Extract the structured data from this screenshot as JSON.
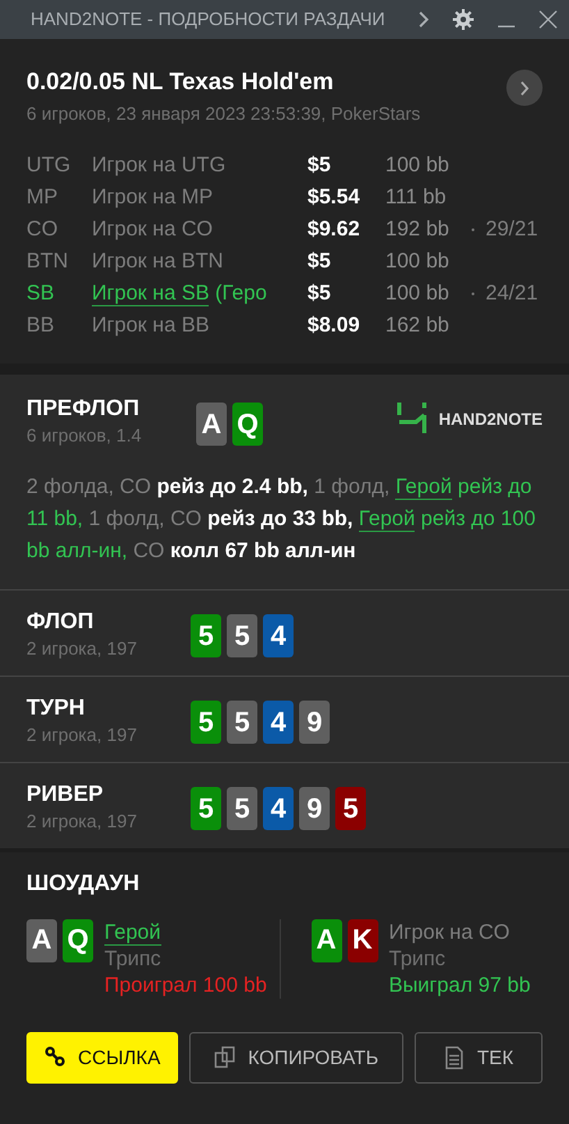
{
  "window": {
    "title": "HAND2NOTE - ПОДРОБНОСТИ РАЗДАЧИ"
  },
  "hand": {
    "title": "0.02/0.05 NL Texas Hold'em",
    "subtitle": "6 игроков, 23 января 2023 23:53:39, PokerStars"
  },
  "players": [
    {
      "position": "UTG",
      "name": "Игрок на UTG",
      "stack": "$5",
      "bb": "100 bb",
      "hero": false
    },
    {
      "position": "MP",
      "name": "Игрок на MP",
      "stack": "$5.54",
      "bb": "111 bb",
      "hero": false
    },
    {
      "position": "CO",
      "name": "Игрок на CO",
      "stack": "$9.62",
      "bb": "192 bb",
      "stat": "29/21",
      "hero": false
    },
    {
      "position": "BTN",
      "name": "Игрок на BTN",
      "stack": "$5",
      "bb": "100 bb",
      "hero": false
    },
    {
      "position": "SB",
      "name": "Игрок на SB",
      "name_suffix": " (Геро",
      "stack": "$5",
      "bb": "100 bb",
      "stat": "24/21",
      "hero": true
    },
    {
      "position": "BB",
      "name": "Игрок на BB",
      "stack": "$8.09",
      "bb": "162 bb",
      "hero": false
    }
  ],
  "preflop": {
    "title": "ПРЕФЛОП",
    "subtitle": "6 игроков, 1.4",
    "logo": "HAND2NOTE",
    "cards": [
      {
        "rank": "A",
        "color": "#5f5f5f"
      },
      {
        "rank": "Q",
        "color": "#0a8f0a"
      }
    ],
    "actions": [
      {
        "text": "2 фолда, CO ",
        "kind": "muted"
      },
      {
        "text": "рейз до 2.4 bb,",
        "kind": "bold"
      },
      {
        "text": " 1 фолд, ",
        "kind": "muted"
      },
      {
        "text": "Герой",
        "kind": "hero-link"
      },
      {
        "text": " рейз до 11 bb,",
        "kind": "hero"
      },
      {
        "text": " 1 фолд, CO ",
        "kind": "muted"
      },
      {
        "text": "рейз до 33 bb, ",
        "kind": "bold"
      },
      {
        "text": "Герой",
        "kind": "hero-link"
      },
      {
        "text": " рейз до 100 bb алл-ин,",
        "kind": "hero"
      },
      {
        "text": " CO ",
        "kind": "muted"
      },
      {
        "text": "колл 67 bb алл-ин",
        "kind": "bold"
      }
    ]
  },
  "streets": [
    {
      "title": "ФЛОП",
      "subtitle": "2 игрока, 197",
      "cards": [
        {
          "rank": "5",
          "color": "#0a8f0a"
        },
        {
          "rank": "5",
          "color": "#5f5f5f"
        },
        {
          "rank": "4",
          "color": "#0b5aa8"
        }
      ]
    },
    {
      "title": "ТУРН",
      "subtitle": "2 игрока, 197",
      "cards": [
        {
          "rank": "5",
          "color": "#0a8f0a"
        },
        {
          "rank": "5",
          "color": "#5f5f5f"
        },
        {
          "rank": "4",
          "color": "#0b5aa8"
        },
        {
          "rank": "9",
          "color": "#5f5f5f"
        }
      ]
    },
    {
      "title": "РИВЕР",
      "subtitle": "2 игрока, 197",
      "cards": [
        {
          "rank": "5",
          "color": "#0a8f0a"
        },
        {
          "rank": "5",
          "color": "#5f5f5f"
        },
        {
          "rank": "4",
          "color": "#0b5aa8"
        },
        {
          "rank": "9",
          "color": "#5f5f5f"
        },
        {
          "rank": "5",
          "color": "#8b0000"
        }
      ]
    }
  ],
  "showdown": {
    "title": "ШОУДАУН",
    "players": [
      {
        "name": "Герой",
        "hero": true,
        "hand": "Трипс",
        "result": "Проиграл 100 bb",
        "won": false,
        "cards": [
          {
            "rank": "A",
            "color": "#5f5f5f"
          },
          {
            "rank": "Q",
            "color": "#0a8f0a"
          }
        ]
      },
      {
        "name": "Игрок на CO",
        "hero": false,
        "hand": "Трипс",
        "result": "Выиграл 97 bb",
        "won": true,
        "cards": [
          {
            "rank": "A",
            "color": "#0a8f0a"
          },
          {
            "rank": "K",
            "color": "#8b0000"
          }
        ]
      }
    ]
  },
  "buttons": [
    {
      "label": "ССЫЛКА",
      "kind": "link",
      "primary": true
    },
    {
      "label": "КОПИРОВАТЬ",
      "kind": "copy",
      "primary": false
    },
    {
      "label": "ТЕК",
      "kind": "text",
      "primary": false
    }
  ]
}
